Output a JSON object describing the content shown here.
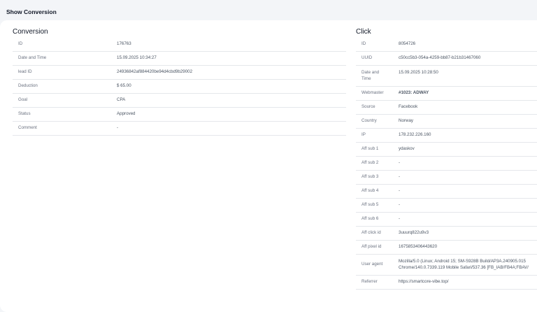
{
  "page": {
    "title": "Show Conversion"
  },
  "conversion": {
    "title": "Conversion",
    "rows": [
      {
        "key": "ID",
        "value": "176763"
      },
      {
        "key": "Date and Time",
        "value": "15.09.2025 10:34:27"
      },
      {
        "key": "lead ID",
        "value": "24936842af884420be94d4cbd9b29002"
      },
      {
        "key": "Deduction",
        "value": "$ 65.00"
      },
      {
        "key": "Goal",
        "value": "CPA"
      },
      {
        "key": "Status",
        "value": "Approved"
      },
      {
        "key": "Comment",
        "value": "-"
      }
    ]
  },
  "click": {
    "title": "Click",
    "rows": [
      {
        "key": "ID",
        "value": "8054726"
      },
      {
        "key": "UUID",
        "value": "c50cc5b3-054a-4259-bb87-b21b31467060"
      },
      {
        "key": "Date and Time",
        "value": "15.09.2025 10:28:50"
      },
      {
        "key": "Webmaster",
        "value": "#1023: ADWAY"
      },
      {
        "key": "Source",
        "value": "Facebook"
      },
      {
        "key": "Country",
        "value": "Norway"
      },
      {
        "key": "IP",
        "value": "178.232.226.160"
      },
      {
        "key": "Aff sub 1",
        "value": "ydaskov"
      },
      {
        "key": "Aff sub 2",
        "value": "-"
      },
      {
        "key": "Aff sub 3",
        "value": "-"
      },
      {
        "key": "Aff sub 4",
        "value": "-"
      },
      {
        "key": "Aff sub 5",
        "value": "-"
      },
      {
        "key": "Aff sub 6",
        "value": "-"
      },
      {
        "key": "Aff click id",
        "value": "3uuurq822u9v3"
      },
      {
        "key": "Aff pixel id",
        "value": "1675853406443620"
      },
      {
        "key": "User agent",
        "value": "Mozilla/5.0 (Linux; Android 15; SM-S928B Build/AP3A.240905.015",
        "value2": "Chrome/140.0.7339.119 Mobile Safari/537.36 [FB_IAB/FB4A;FBAV/"
      },
      {
        "key": "Referrer",
        "value": "https://smartcore-vibe.top/"
      }
    ]
  },
  "colors": {
    "link": "#2563eb",
    "background": "#f3f5f8",
    "panel": "#ffffff"
  }
}
